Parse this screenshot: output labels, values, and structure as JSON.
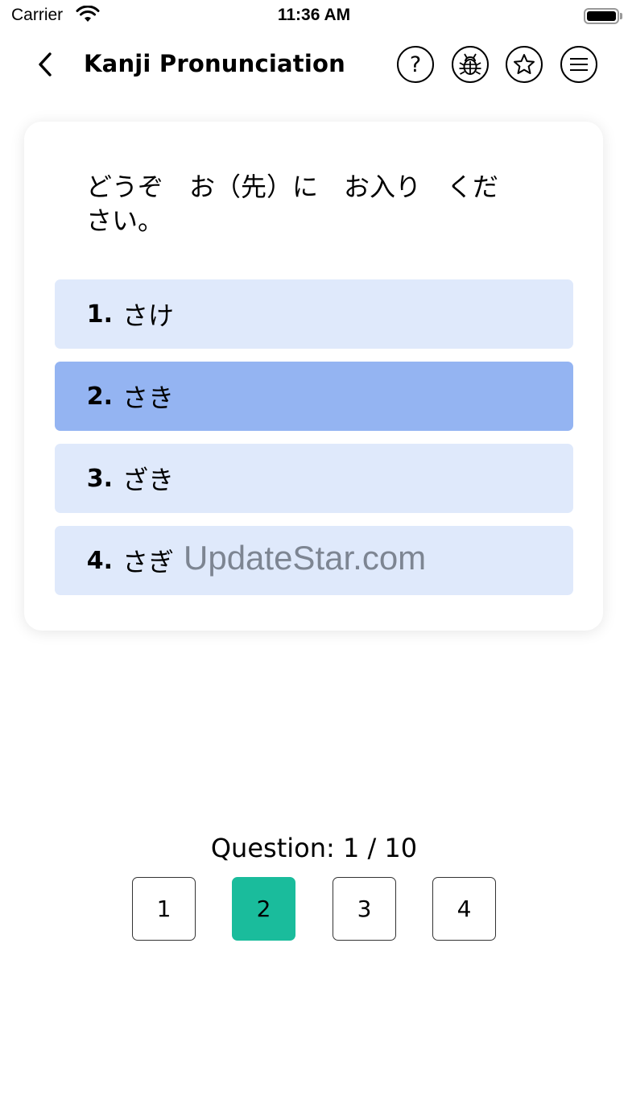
{
  "status_bar": {
    "carrier": "Carrier",
    "time": "11:36 AM"
  },
  "header": {
    "title": "Kanji Pronunciation",
    "help_glyph": "?",
    "icons": [
      "chevron-left-icon",
      "help-icon",
      "bug-icon",
      "star-icon",
      "menu-icon"
    ]
  },
  "question": {
    "text": "どうぞ　お（先）に　お入り　ください。"
  },
  "options": [
    {
      "number": "1.",
      "text": "さけ",
      "selected": false
    },
    {
      "number": "2.",
      "text": "さき",
      "selected": true
    },
    {
      "number": "3.",
      "text": "ざき",
      "selected": false
    },
    {
      "number": "4.",
      "text": "さぎ",
      "selected": false
    }
  ],
  "watermark": "UpdateStar.com",
  "progress": {
    "label": "Question: 1 / 10",
    "current": 1,
    "total": 10
  },
  "pager": [
    {
      "label": "1",
      "active": false
    },
    {
      "label": "2",
      "active": true
    },
    {
      "label": "3",
      "active": false
    },
    {
      "label": "4",
      "active": false
    }
  ],
  "colors": {
    "option_bg": "#dfe9fb",
    "option_selected_bg": "#94b4f2",
    "pager_active_bg": "#1abc9c"
  }
}
